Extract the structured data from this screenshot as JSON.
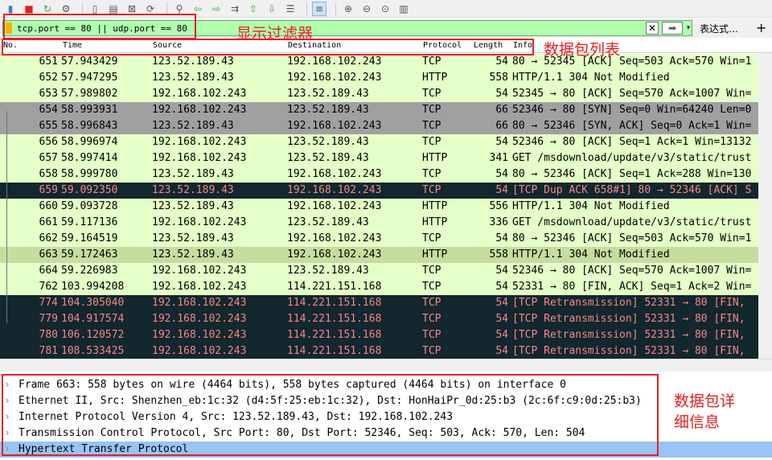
{
  "toolbar": {
    "icons": [
      "file-icon",
      "stop-capture-icon",
      "restart-capture-icon",
      "options-icon",
      "open-icon",
      "save-icon",
      "close-file-icon",
      "reload-icon",
      "find-icon",
      "back-icon",
      "forward-icon",
      "go-to-icon",
      "first-icon",
      "last-icon",
      "autoscroll-icon",
      "colorize-icon",
      "zoom-in-icon",
      "zoom-out-icon",
      "zoom-normal-icon",
      "resize-columns-icon"
    ]
  },
  "filter": {
    "value": "tcp.port == 80 || udp.port == 80",
    "clear_glyph": "✕",
    "apply_glyph": "➡",
    "drop_glyph": "▾",
    "expression_label": "表达式…",
    "plus_label": "+"
  },
  "columns": {
    "no": "No.",
    "time": "Time",
    "source": "Source",
    "destination": "Destination",
    "protocol": "Protocol",
    "length": "Length",
    "info": "Info"
  },
  "packets": [
    {
      "no": "651",
      "time": "57.943429",
      "src": "123.52.189.43",
      "dst": "192.168.102.243",
      "proto": "TCP",
      "len": "54",
      "info": "80 → 52345 [ACK] Seq=503 Ack=570 Win=1",
      "style": "http"
    },
    {
      "no": "652",
      "time": "57.947295",
      "src": "123.52.189.43",
      "dst": "192.168.102.243",
      "proto": "HTTP",
      "len": "558",
      "info": "HTTP/1.1 304 Not Modified",
      "style": "http"
    },
    {
      "no": "653",
      "time": "57.989802",
      "src": "192.168.102.243",
      "dst": "123.52.189.43",
      "proto": "TCP",
      "len": "54",
      "info": "52345 → 80 [ACK] Seq=570 Ack=1007 Win=",
      "style": "http"
    },
    {
      "no": "654",
      "time": "58.993931",
      "src": "192.168.102.243",
      "dst": "123.52.189.43",
      "proto": "TCP",
      "len": "66",
      "info": "52346 → 80 [SYN] Seq=0 Win=64240 Len=0",
      "style": "syn"
    },
    {
      "no": "655",
      "time": "58.996843",
      "src": "123.52.189.43",
      "dst": "192.168.102.243",
      "proto": "TCP",
      "len": "66",
      "info": "80 → 52346 [SYN, ACK] Seq=0 Ack=1 Win=",
      "style": "syn"
    },
    {
      "no": "656",
      "time": "58.996974",
      "src": "192.168.102.243",
      "dst": "123.52.189.43",
      "proto": "TCP",
      "len": "54",
      "info": "52346 → 80 [ACK] Seq=1 Ack=1 Win=13132",
      "style": "http"
    },
    {
      "no": "657",
      "time": "58.997414",
      "src": "192.168.102.243",
      "dst": "123.52.189.43",
      "proto": "HTTP",
      "len": "341",
      "info": "GET /msdownload/update/v3/static/trust",
      "style": "http"
    },
    {
      "no": "658",
      "time": "58.999780",
      "src": "123.52.189.43",
      "dst": "192.168.102.243",
      "proto": "TCP",
      "len": "54",
      "info": "80 → 52346 [ACK] Seq=1 Ack=288 Win=130",
      "style": "http"
    },
    {
      "no": "659",
      "time": "59.092350",
      "src": "123.52.189.43",
      "dst": "192.168.102.243",
      "proto": "TCP",
      "len": "54",
      "info": "[TCP Dup ACK 658#1] 80 → 52346 [ACK] S",
      "style": "bad"
    },
    {
      "no": "660",
      "time": "59.093728",
      "src": "123.52.189.43",
      "dst": "192.168.102.243",
      "proto": "HTTP",
      "len": "556",
      "info": "HTTP/1.1 304 Not Modified",
      "style": "http"
    },
    {
      "no": "661",
      "time": "59.117136",
      "src": "192.168.102.243",
      "dst": "123.52.189.43",
      "proto": "HTTP",
      "len": "336",
      "info": "GET /msdownload/update/v3/static/trust",
      "style": "http"
    },
    {
      "no": "662",
      "time": "59.164519",
      "src": "123.52.189.43",
      "dst": "192.168.102.243",
      "proto": "TCP",
      "len": "54",
      "info": "80 → 52346 [ACK] Seq=503 Ack=570 Win=1",
      "style": "http"
    },
    {
      "no": "663",
      "time": "59.172463",
      "src": "123.52.189.43",
      "dst": "192.168.102.243",
      "proto": "HTTP",
      "len": "558",
      "info": "HTTP/1.1 304 Not Modified",
      "style": "selected"
    },
    {
      "no": "664",
      "time": "59.226983",
      "src": "192.168.102.243",
      "dst": "123.52.189.43",
      "proto": "TCP",
      "len": "54",
      "info": "52346 → 80 [ACK] Seq=570 Ack=1007 Win=",
      "style": "http"
    },
    {
      "no": "762",
      "time": "103.994208",
      "src": "192.168.102.243",
      "dst": "114.221.151.168",
      "proto": "TCP",
      "len": "54",
      "info": "52331 → 80 [FIN, ACK] Seq=1 Ack=2 Win=",
      "style": "http"
    },
    {
      "no": "774",
      "time": "104.305040",
      "src": "192.168.102.243",
      "dst": "114.221.151.168",
      "proto": "TCP",
      "len": "54",
      "info": "[TCP Retransmission] 52331 → 80 [FIN,",
      "style": "bad"
    },
    {
      "no": "779",
      "time": "104.917574",
      "src": "192.168.102.243",
      "dst": "114.221.151.168",
      "proto": "TCP",
      "len": "54",
      "info": "[TCP Retransmission] 52331 → 80 [FIN,",
      "style": "bad"
    },
    {
      "no": "780",
      "time": "106.120572",
      "src": "192.168.102.243",
      "dst": "114.221.151.168",
      "proto": "TCP",
      "len": "54",
      "info": "[TCP Retransmission] 52331 → 80 [FIN,",
      "style": "bad"
    },
    {
      "no": "781",
      "time": "108.533425",
      "src": "192.168.102.243",
      "dst": "114.221.151.168",
      "proto": "TCP",
      "len": "54",
      "info": "[TCP Retransmission] 52331 → 80 [FIN,",
      "style": "bad"
    }
  ],
  "details": [
    {
      "text": "Frame 663: 558 bytes on wire (4464 bits), 558 bytes captured (4464 bits) on interface 0",
      "selected": false
    },
    {
      "text": "Ethernet II, Src: Shenzhen_eb:1c:32 (d4:5f:25:eb:1c:32), Dst: HonHaiPr_0d:25:b3 (2c:6f:c9:0d:25:b3)",
      "selected": false
    },
    {
      "text": "Internet Protocol Version 4, Src: 123.52.189.43, Dst: 192.168.102.243",
      "selected": false
    },
    {
      "text": "Transmission Control Protocol, Src Port: 80, Dst Port: 52346, Seq: 503, Ack: 570, Len: 504",
      "selected": false
    },
    {
      "text": "Hypertext Transfer Protocol",
      "selected": true
    }
  ],
  "annotations": {
    "filter": "显示过滤器",
    "packet_list": "数据包列表",
    "details": [
      "数据包详",
      "细信息"
    ]
  },
  "colors": {
    "http_bg": "#e4ffc7",
    "bad_bg": "#12272e",
    "bad_fg": "#f78787",
    "selected_bg": "#c7dda0",
    "syn_bg": "#a0a0a0",
    "detail_sel": "#99c4f7",
    "annotation": "#e52020"
  }
}
